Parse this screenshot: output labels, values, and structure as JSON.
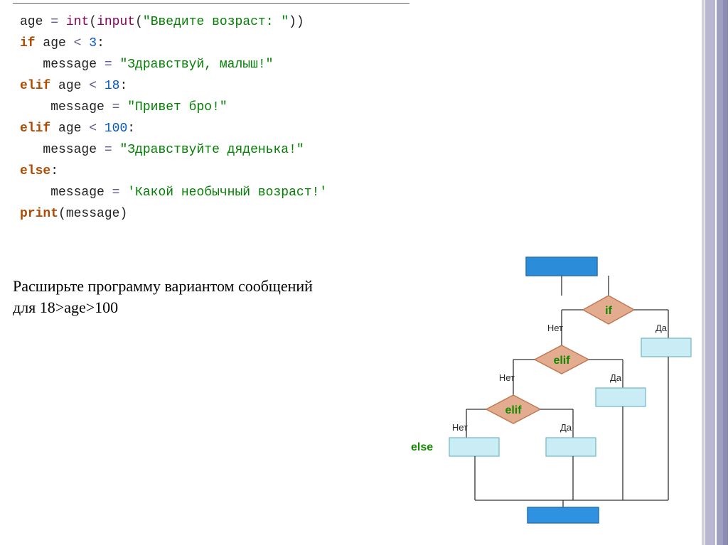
{
  "code": {
    "l1_a": "age ",
    "l1_op1": "=",
    "l1_b": " ",
    "l1_fn1": "int",
    "l1_p1": "(",
    "l1_fn2": "input",
    "l1_p2": "(",
    "l1_str": "\"Введите возраст: \"",
    "l1_p3": "))",
    "l2_kw": "if",
    "l2_a": " age ",
    "l2_op": "<",
    "l2_sp": " ",
    "l2_num": "3",
    "l2_c": ":",
    "l3_a": "   message ",
    "l3_op": "=",
    "l3_sp": " ",
    "l3_str": "\"Здравствуй, малыш!\"",
    "l4_kw": "elif",
    "l4_a": " age ",
    "l4_op": "<",
    "l4_sp": " ",
    "l4_num": "18",
    "l4_c": ":",
    "l5_a": "    message ",
    "l5_op": "=",
    "l5_sp": " ",
    "l5_str": "\"Привет бро!\"",
    "l6_kw": "elif",
    "l6_a": " age ",
    "l6_op": "<",
    "l6_sp": " ",
    "l6_num": "100",
    "l6_c": ":",
    "l7_a": "   message ",
    "l7_op": "=",
    "l7_sp": " ",
    "l7_str": "\"Здравствуйте дяденька!\"",
    "l8_kw": "else",
    "l8_c": ":",
    "l9_a": "    message ",
    "l9_op": "=",
    "l9_sp": " ",
    "l9_str": "'Какой необычный возраст!'",
    "l10_fn": "print",
    "l10_p1": "(",
    "l10_arg": "message",
    "l10_p2": ")"
  },
  "task": {
    "line1": "Расширьте программу вариантом сообщений",
    "line2": "для 18>age>100"
  },
  "flow": {
    "if": "if",
    "elif": "elif",
    "else": "else",
    "no": "Нет",
    "yes": "Да"
  }
}
